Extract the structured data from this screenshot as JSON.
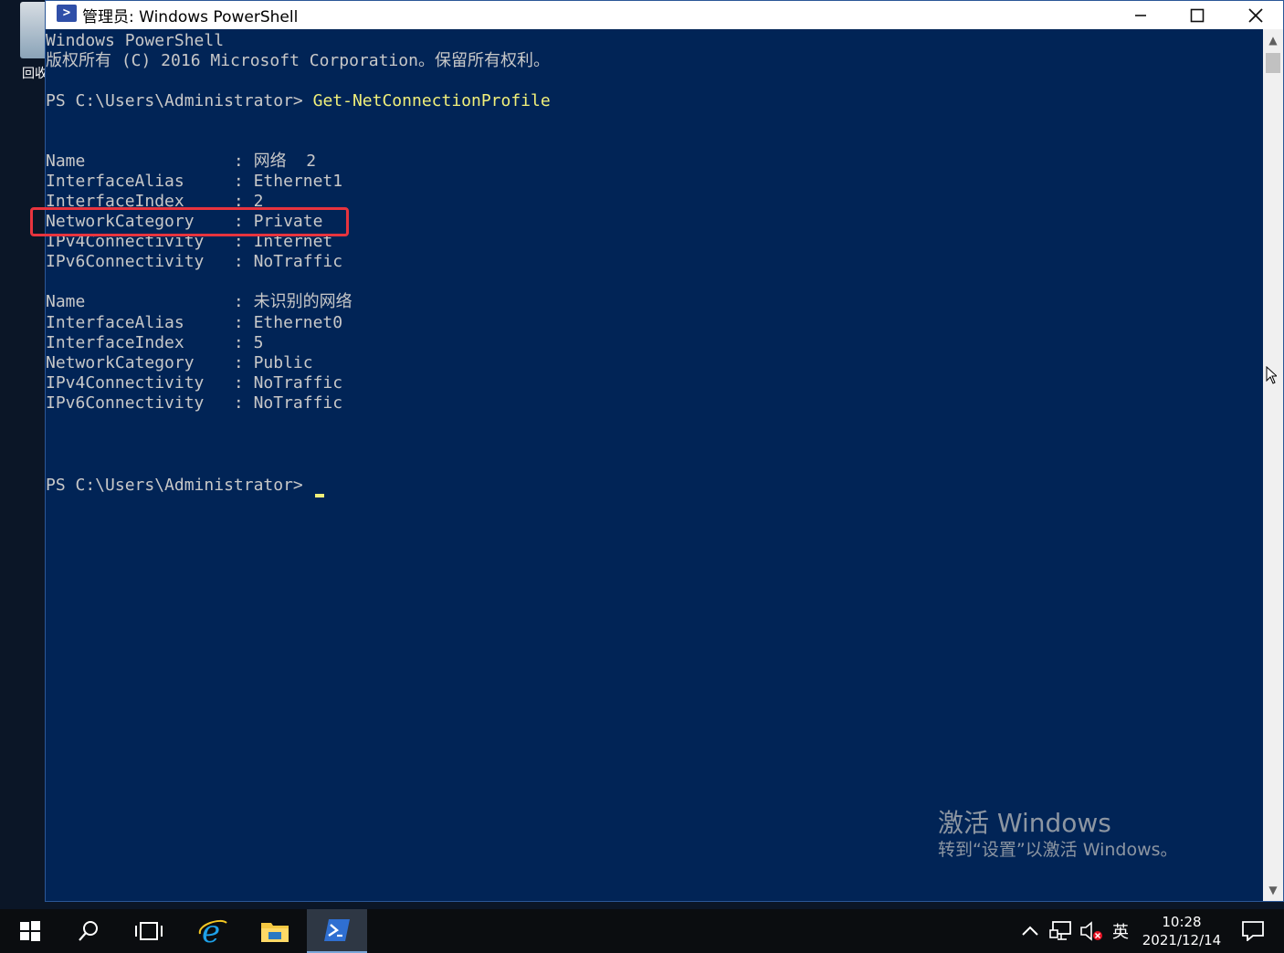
{
  "desktop": {
    "recycle_bin_label": "回收"
  },
  "window": {
    "title": "管理员: Windows PowerShell",
    "buttons": {
      "minimize": "minimize-icon",
      "maximize": "maximize-icon",
      "close": "close-icon"
    }
  },
  "console": {
    "lines": [
      "Windows PowerShell",
      "版权所有 (C) 2016 Microsoft Corporation。保留所有权利。",
      "",
      "PS C:\\Users\\Administrator> ",
      "",
      "",
      "Name               : 网络  2",
      "InterfaceAlias     : Ethernet1",
      "InterfaceIndex     : 2",
      "NetworkCategory    : Private",
      "IPv4Connectivity   : Internet",
      "IPv6Connectivity   : NoTraffic",
      "",
      "Name               : 未识别的网络",
      "InterfaceAlias     : Ethernet0",
      "InterfaceIndex     : 5",
      "NetworkCategory    : Public",
      "IPv4Connectivity   : NoTraffic",
      "IPv6Connectivity   : NoTraffic",
      "",
      "",
      "",
      "PS C:\\Users\\Administrator> "
    ],
    "command": "Get-NetConnectionProfile",
    "cursor_color": "#f1f07a",
    "highlight_color": "#e8343e",
    "background_color": "#012456"
  },
  "watermark": {
    "title": "激活 Windows",
    "subtitle": "转到“设置”以激活 Windows。"
  },
  "taskbar": {
    "start": "windows-start-icon",
    "search": "search-icon",
    "task_view": "task-view-icon",
    "ie": "internet-explorer-icon",
    "explorer": "file-explorer-icon",
    "powershell": "powershell-icon",
    "tray": {
      "chevron": "chevron-up-icon",
      "network": "network-icon",
      "volume": "volume-muted-icon",
      "ime": "英"
    },
    "time": "10:28",
    "date": "2021/12/14",
    "notification": "notification-icon"
  }
}
